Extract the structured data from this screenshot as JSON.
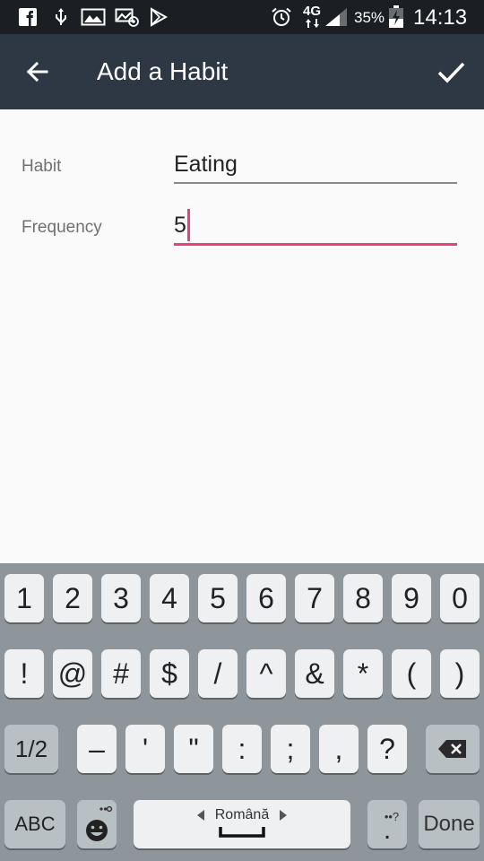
{
  "status_bar": {
    "network": "4G",
    "battery": "35%",
    "time": "14:13"
  },
  "app_bar": {
    "title": "Add a Habit"
  },
  "form": {
    "habit_label": "Habit",
    "habit_value": "Eating",
    "frequency_label": "Frequency",
    "frequency_value": "5"
  },
  "keyboard": {
    "row1": [
      "1",
      "2",
      "3",
      "4",
      "5",
      "6",
      "7",
      "8",
      "9",
      "0"
    ],
    "row2": [
      "!",
      "@",
      "#",
      "$",
      "/",
      "^",
      "&",
      "*",
      "(",
      ")"
    ],
    "row3_toggle": "1/2",
    "row3": [
      "–",
      "'",
      "\"",
      ":",
      ";",
      ",",
      "?"
    ],
    "abc": "ABC",
    "space_language": "Română",
    "done": "Done",
    "punct_hint": "••?",
    "punct_main": "."
  },
  "colors": {
    "status_bar": "#1b1f23",
    "app_bar": "#2e3845",
    "accent": "#e8407a",
    "keyboard_bg": "#8e969b"
  }
}
